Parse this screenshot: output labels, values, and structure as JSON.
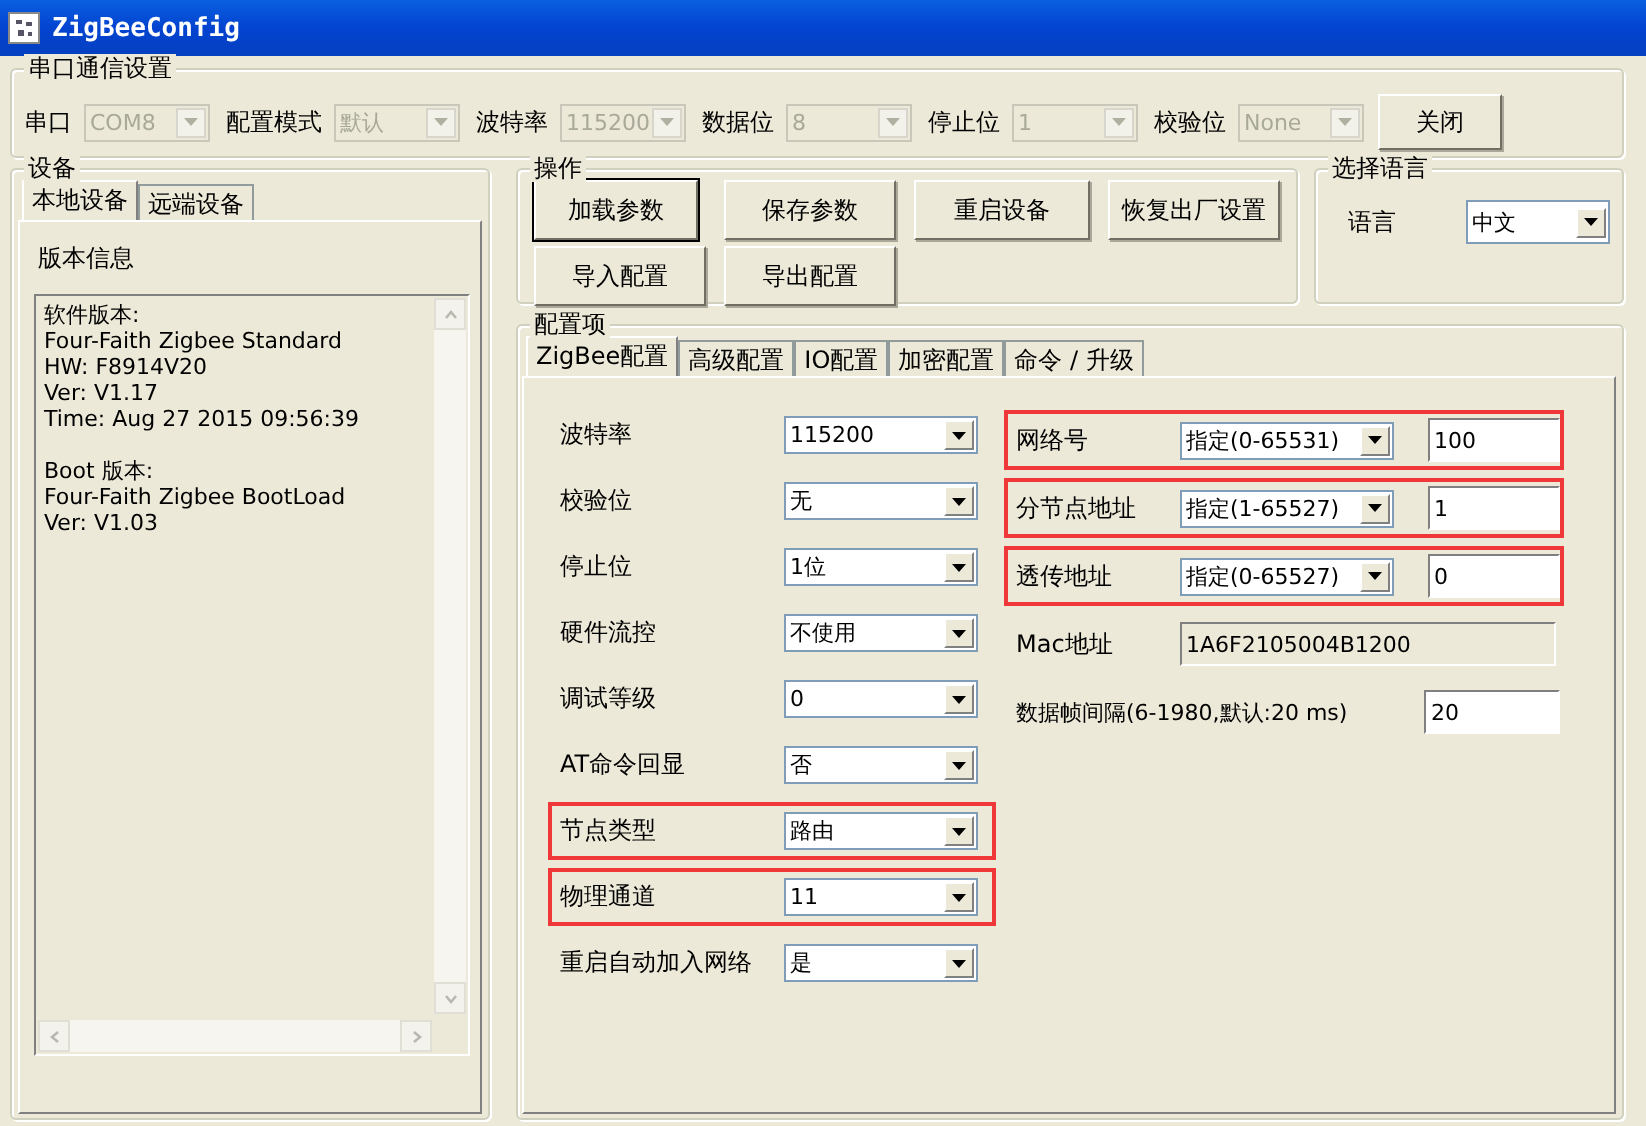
{
  "window": {
    "title": "ZigBeeConfig"
  },
  "serial": {
    "title": "串口通信设置",
    "fields": [
      {
        "label": "串口",
        "value": "COM8",
        "disabled": true
      },
      {
        "label": "配置模式",
        "value": "默认",
        "disabled": true
      },
      {
        "label": "波特率",
        "value": "115200",
        "disabled": true
      },
      {
        "label": "数据位",
        "value": "8",
        "disabled": true
      },
      {
        "label": "停止位",
        "value": "1",
        "disabled": true
      },
      {
        "label": "校验位",
        "value": "None",
        "disabled": true
      }
    ],
    "button": "关闭"
  },
  "device": {
    "title": "设备",
    "tabs": [
      {
        "label": "本地设备",
        "selected": true
      },
      {
        "label": "远端设备",
        "selected": false
      }
    ],
    "heading": "版本信息",
    "info_blocks": [
      [
        "软件版本:",
        "Four-Faith Zigbee Standard",
        "HW: F8914V20",
        "Ver: V1.17",
        "Time: Aug 27 2015 09:56:39"
      ],
      [
        "Boot 版本:",
        "Four-Faith Zigbee BootLoad",
        "Ver: V1.03"
      ]
    ]
  },
  "operations": {
    "title": "操作",
    "buttons": [
      {
        "label": "加载参数",
        "focused": true
      },
      {
        "label": "保存参数",
        "focused": false
      },
      {
        "label": "重启设备",
        "focused": false
      },
      {
        "label": "恢复出厂设置",
        "focused": false
      },
      {
        "label": "导入配置",
        "focused": false
      },
      {
        "label": "导出配置",
        "focused": false
      }
    ]
  },
  "language": {
    "title": "选择语言",
    "label": "语言",
    "value": "中文"
  },
  "config": {
    "title": "配置项",
    "tabs": [
      {
        "label": "ZigBee配置",
        "selected": true
      },
      {
        "label": "高级配置",
        "selected": false
      },
      {
        "label": "IO配置",
        "selected": false
      },
      {
        "label": "加密配置",
        "selected": false
      },
      {
        "label": "命令 / 升级",
        "selected": false
      }
    ],
    "left_fields": [
      {
        "label": "波特率",
        "value": "115200",
        "highlighted": false
      },
      {
        "label": "校验位",
        "value": "无",
        "highlighted": false
      },
      {
        "label": "停止位",
        "value": "1位",
        "highlighted": false
      },
      {
        "label": "硬件流控",
        "value": "不使用",
        "highlighted": false
      },
      {
        "label": "调试等级",
        "value": "0",
        "highlighted": false
      },
      {
        "label": "AT命令回显",
        "value": "否",
        "highlighted": false
      },
      {
        "label": "节点类型",
        "value": "路由",
        "highlighted": true
      },
      {
        "label": "物理通道",
        "value": "11",
        "highlighted": true
      },
      {
        "label": "重启自动加入网络",
        "value": "是",
        "highlighted": false
      }
    ],
    "right_fields": [
      {
        "kind": "combo_input",
        "label": "网络号",
        "mode": "指定(0-65531)",
        "value": "100",
        "highlighted": true
      },
      {
        "kind": "combo_input",
        "label": "分节点地址",
        "mode": "指定(1-65527)",
        "value": "1",
        "highlighted": true
      },
      {
        "kind": "combo_input",
        "label": "透传地址",
        "mode": "指定(0-65527)",
        "value": "0",
        "highlighted": true
      },
      {
        "kind": "readonly",
        "label": "Mac地址",
        "value": "1A6F2105004B1200",
        "highlighted": false
      },
      {
        "kind": "input",
        "label": "数据帧间隔(6-1980,默认:20 ms)",
        "value": "20",
        "highlighted": false
      }
    ]
  }
}
